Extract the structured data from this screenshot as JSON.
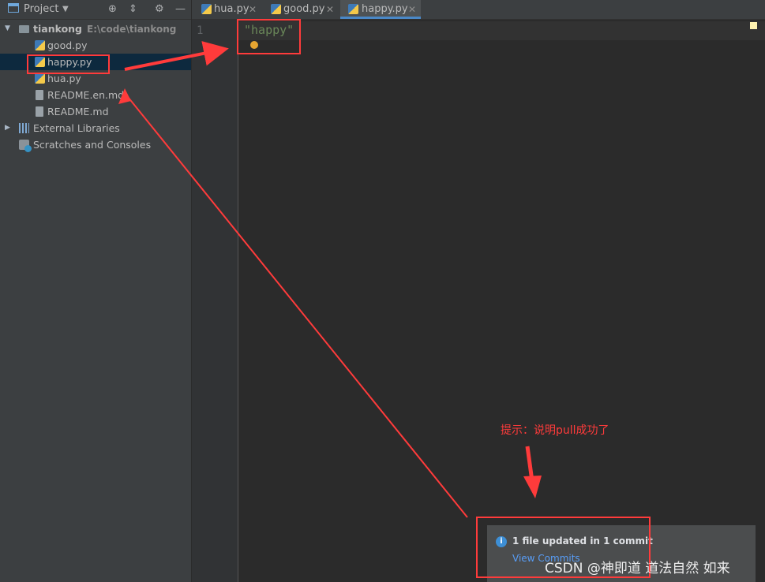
{
  "project_panel": {
    "title": "Project",
    "tree": [
      {
        "label": "tiankong",
        "path": "E:\\code\\tiankong",
        "type": "folder"
      },
      {
        "label": "good.py",
        "type": "python"
      },
      {
        "label": "happy.py",
        "type": "python",
        "selected": true
      },
      {
        "label": "hua.py",
        "type": "python"
      },
      {
        "label": "README.en.md",
        "type": "markdown"
      },
      {
        "label": "README.md",
        "type": "markdown"
      },
      {
        "label": "External Libraries",
        "type": "library"
      },
      {
        "label": "Scratches and Consoles",
        "type": "scratch"
      }
    ]
  },
  "tabs": [
    {
      "label": "hua.py"
    },
    {
      "label": "good.py"
    },
    {
      "label": "happy.py",
      "active": true
    }
  ],
  "editor": {
    "line_number": "1",
    "code": "\"happy\""
  },
  "annotation": {
    "hint": "提示：说明pull成功了"
  },
  "notification": {
    "title": "1 file updated in 1 commit",
    "link": "View Commits"
  },
  "watermark": "CSDN @神即道 道法自然 如来",
  "colors": {
    "panel_bg": "#3c3f41",
    "editor_bg": "#2b2b2b",
    "selection": "#0d293e",
    "string": "#6a8759",
    "annotation_red": "#ff3b3b",
    "link": "#589df6"
  }
}
